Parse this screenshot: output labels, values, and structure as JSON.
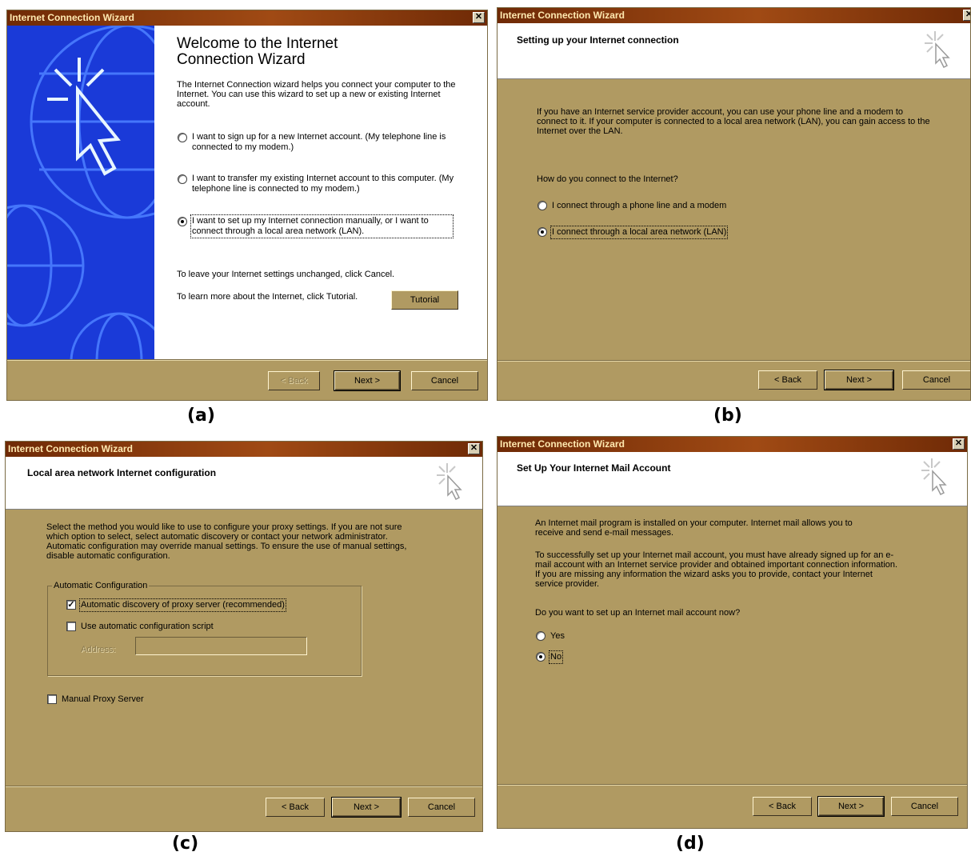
{
  "captions": {
    "a": "(a)",
    "b": "(b)",
    "c": "(c)",
    "d": "(d)"
  },
  "icons": {
    "close": "close-icon",
    "wand": "wizard-wand-icon",
    "globe": "globe-pointer-icon"
  },
  "colors": {
    "dialog_bg": "#b09a62",
    "title_gradient": "#a04a14",
    "sidebar_blue": "#1a3ad8"
  },
  "panel_a": {
    "title": "Internet Connection Wizard",
    "heading_line1": "Welcome to the Internet",
    "heading_line2": "Connection Wizard",
    "intro": "The Internet Connection wizard helps you connect your computer to the Internet.  You can use this wizard to set up a new or existing Internet account.",
    "option1": "I want to sign up for a new Internet account. (My telephone line is connected to my modem.)",
    "option2": "I want to transfer my existing Internet account to this computer. (My telephone line is connected to my modem.)",
    "option3": "I want to set up my Internet connection manually, or I want to connect through a local area network (LAN).",
    "cancel_note": "To leave your Internet settings unchanged, click Cancel.",
    "tutorial_note": "To learn more about the Internet, click Tutorial.",
    "tutorial_button": "Tutorial",
    "back_button": "< Back",
    "next_button": "Next >",
    "cancel_button": "Cancel"
  },
  "panel_b": {
    "title": "Internet Connection Wizard",
    "header": "Setting up your Internet connection",
    "intro": "If you have an Internet service provider account, you can use your phone line and a modem to connect to it. If your computer is connected to a local area network (LAN), you can gain access to the Internet over the LAN.",
    "question": "How do you connect to the Internet?",
    "option1": "I connect through a phone line and a modem",
    "option2": "I connect through a local area network (LAN)",
    "back_button": "< Back",
    "next_button": "Next >",
    "cancel_button": "Cancel"
  },
  "panel_c": {
    "title": "Internet Connection Wizard",
    "header": "Local area network Internet configuration",
    "intro": "Select the method you would like to use to configure your proxy settings.  If you are not sure which option to select, select automatic discovery or contact your network administrator.  Automatic configuration may override manual settings.  To ensure the use of manual settings, disable automatic configuration.",
    "group_label": "Automatic Configuration",
    "check1": "Automatic discovery of proxy server (recommended)",
    "check2": "Use automatic configuration script",
    "address_label": "Address:",
    "check3": "Manual Proxy Server",
    "back_button": "< Back",
    "next_button": "Next >",
    "cancel_button": "Cancel"
  },
  "panel_d": {
    "title": "Internet Connection Wizard",
    "header": "Set Up Your Internet Mail Account",
    "para1": "An Internet mail program is installed on your computer. Internet mail allows you to receive and send e-mail messages.",
    "para2": "To successfully set up your Internet mail account, you must have already signed up for an e-mail account with an Internet service provider and obtained important connection information. If you are missing any information the wizard asks you to provide, contact your Internet service provider.",
    "question": "Do you want to set up an Internet mail account now?",
    "yes": "Yes",
    "no": "No",
    "back_button": "< Back",
    "next_button": "Next >",
    "cancel_button": "Cancel"
  }
}
